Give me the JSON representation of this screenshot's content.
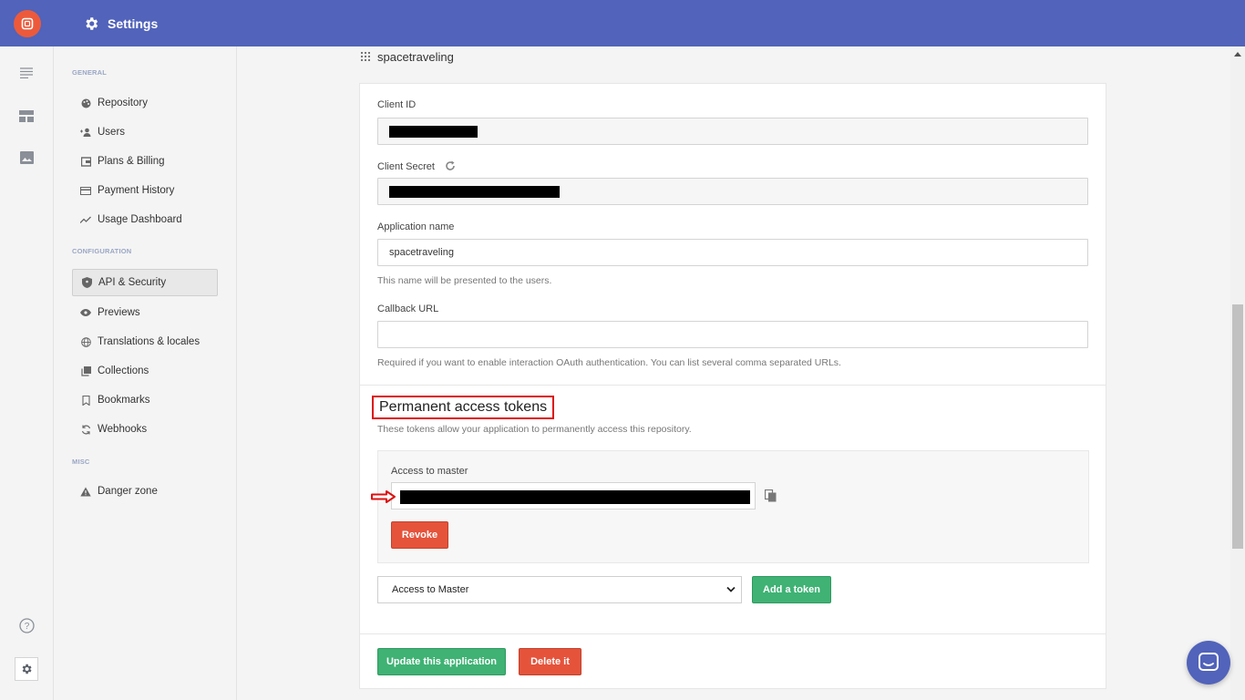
{
  "header": {
    "title": "Settings",
    "gear_icon": "gear-icon",
    "background": "#5163ba"
  },
  "rail": {
    "logo_color": "#ec5a3b",
    "icons": [
      "list-icon",
      "layout-icon",
      "image-icon"
    ],
    "bottom_icons": [
      "help-icon",
      "gear-icon"
    ]
  },
  "sidebar": {
    "sections": {
      "general": "GENERAL",
      "configuration": "CONFIGURATION",
      "misc": "MISC"
    },
    "items": [
      {
        "label": "Repository",
        "icon": "palette-icon"
      },
      {
        "label": "Users",
        "icon": "add-user-icon"
      },
      {
        "label": "Plans & Billing",
        "icon": "wallet-icon"
      },
      {
        "label": "Payment History",
        "icon": "credit-card-icon"
      },
      {
        "label": "Usage Dashboard",
        "icon": "trend-icon"
      },
      {
        "label": "API & Security",
        "icon": "shield-icon",
        "active": true
      },
      {
        "label": "Previews",
        "icon": "eye-icon"
      },
      {
        "label": "Translations & locales",
        "icon": "globe-icon"
      },
      {
        "label": "Collections",
        "icon": "collections-icon"
      },
      {
        "label": "Bookmarks",
        "icon": "bookmark-icon"
      },
      {
        "label": "Webhooks",
        "icon": "webhook-icon"
      },
      {
        "label": "Danger zone",
        "icon": "warning-icon"
      }
    ]
  },
  "app": {
    "name": "spacetraveling",
    "client_id_label": "Client ID",
    "client_secret_label": "Client Secret",
    "application_name_label": "Application name",
    "application_name_value": "spacetraveling",
    "application_name_help": "This name will be presented to the users.",
    "callback_url_label": "Callback URL",
    "callback_url_value": "",
    "callback_url_help": "Required if you want to enable interaction OAuth authentication. You can list several comma separated URLs."
  },
  "tokens": {
    "title": "Permanent access tokens",
    "description": "These tokens allow your application to permanently access this repository.",
    "access_label": "Access to master",
    "revoke_label": "Revoke",
    "select_value": "Access to Master",
    "add_label": "Add a token"
  },
  "footer": {
    "update_label": "Update this application",
    "delete_label": "Delete it"
  },
  "colors": {
    "danger": "#e5533b",
    "success": "#3fb274",
    "highlight": "#dd1111"
  }
}
